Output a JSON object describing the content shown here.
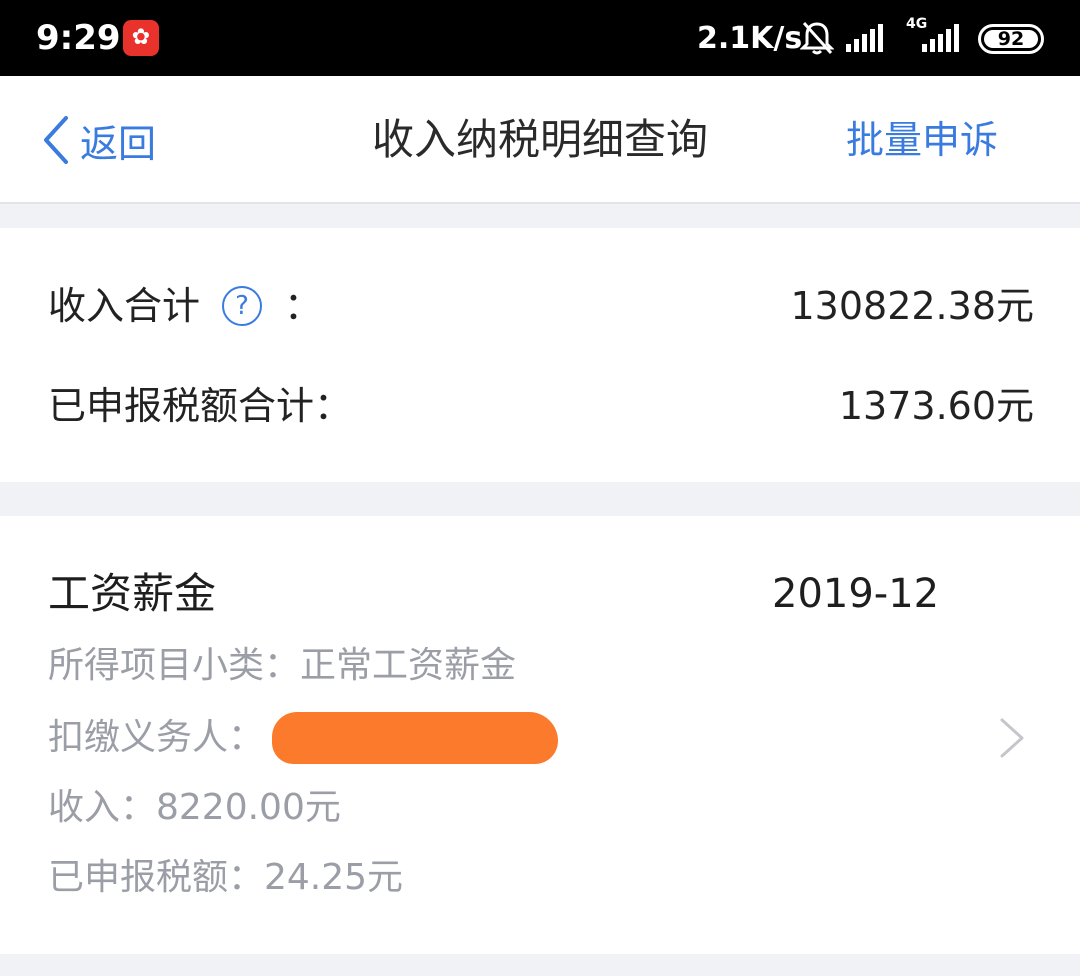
{
  "status_bar": {
    "time": "9:29",
    "app_icon": "app-logo-icon",
    "network_speed": "2.1K/s",
    "network_type": "4G",
    "battery": "92",
    "colors": {
      "background": "#000000",
      "text": "#ffffff",
      "app_icon_bg": "#e8322b"
    }
  },
  "nav": {
    "back_label": "返回",
    "title": "收入纳税明细查询",
    "action_label": "批量申诉",
    "accent_color": "#3a7be0"
  },
  "summary": {
    "income_total_label": "收入合计",
    "help_symbol": "?",
    "colon": "：",
    "income_total_value": "130822.38元",
    "tax_total_label": "已申报税额合计：",
    "tax_total_value": "1373.60元"
  },
  "records": [
    {
      "category": "工资薪金",
      "period": "2019-12",
      "subcategory": "所得项目小类：正常工资薪金",
      "withholder_label": "扣缴义务人：",
      "income": "收入：8220.00元",
      "tax": "已申报税额：24.25元",
      "redaction_color": "#fb7a2c"
    }
  ]
}
